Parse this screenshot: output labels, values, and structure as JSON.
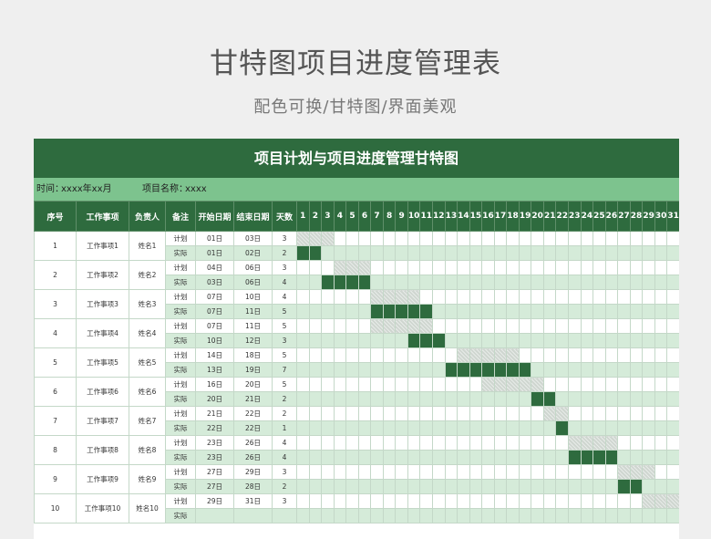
{
  "page": {
    "title": "甘特图项目进度管理表",
    "subtitle": "配色可换/甘特图/界面美观",
    "banner": "项目计划与项目进度管理甘特图",
    "info": {
      "time_label": "时间：",
      "time_value": "xxxx年xx月",
      "project_label": "项目名称：",
      "project_value": "xxxx"
    },
    "headers": {
      "seq": "序号",
      "task": "工作事项",
      "owner": "负责人",
      "note": "备注",
      "start": "开始日期",
      "end": "结束日期",
      "days": "天数"
    },
    "days": [
      "1",
      "2",
      "3",
      "4",
      "5",
      "6",
      "7",
      "8",
      "9",
      "10",
      "11",
      "12",
      "13",
      "14",
      "15",
      "16",
      "17",
      "18",
      "19",
      "20",
      "21",
      "22",
      "23",
      "24",
      "25",
      "26",
      "27",
      "28",
      "29",
      "30",
      "31"
    ]
  },
  "colors": {
    "header_green": "#2e6b3e",
    "info_green": "#7dc38e",
    "actual_row": "#d5ebd9",
    "plan_bar": "#cfd6d0",
    "actual_bar": "#2e6b3e"
  },
  "tasks": [
    {
      "seq": "1",
      "name": "工作事项1",
      "owner": "姓名1",
      "plan": {
        "label": "计划",
        "start": "01日",
        "end": "03日",
        "days": "3",
        "s": 1,
        "e": 3
      },
      "actual": {
        "label": "实际",
        "start": "01日",
        "end": "02日",
        "days": "2",
        "s": 1,
        "e": 2
      }
    },
    {
      "seq": "2",
      "name": "工作事项2",
      "owner": "姓名2",
      "plan": {
        "label": "计划",
        "start": "04日",
        "end": "06日",
        "days": "3",
        "s": 4,
        "e": 6
      },
      "actual": {
        "label": "实际",
        "start": "03日",
        "end": "06日",
        "days": "4",
        "s": 3,
        "e": 6
      }
    },
    {
      "seq": "3",
      "name": "工作事项3",
      "owner": "姓名3",
      "plan": {
        "label": "计划",
        "start": "07日",
        "end": "10日",
        "days": "4",
        "s": 7,
        "e": 10
      },
      "actual": {
        "label": "实际",
        "start": "07日",
        "end": "11日",
        "days": "5",
        "s": 7,
        "e": 11
      }
    },
    {
      "seq": "4",
      "name": "工作事项4",
      "owner": "姓名4",
      "plan": {
        "label": "计划",
        "start": "07日",
        "end": "11日",
        "days": "5",
        "s": 7,
        "e": 11
      },
      "actual": {
        "label": "实际",
        "start": "10日",
        "end": "12日",
        "days": "3",
        "s": 10,
        "e": 12
      }
    },
    {
      "seq": "5",
      "name": "工作事项5",
      "owner": "姓名5",
      "plan": {
        "label": "计划",
        "start": "14日",
        "end": "18日",
        "days": "5",
        "s": 14,
        "e": 18
      },
      "actual": {
        "label": "实际",
        "start": "13日",
        "end": "19日",
        "days": "7",
        "s": 13,
        "e": 19
      }
    },
    {
      "seq": "6",
      "name": "工作事项6",
      "owner": "姓名6",
      "plan": {
        "label": "计划",
        "start": "16日",
        "end": "20日",
        "days": "5",
        "s": 16,
        "e": 20
      },
      "actual": {
        "label": "实际",
        "start": "20日",
        "end": "21日",
        "days": "2",
        "s": 20,
        "e": 21
      }
    },
    {
      "seq": "7",
      "name": "工作事项7",
      "owner": "姓名7",
      "plan": {
        "label": "计划",
        "start": "21日",
        "end": "22日",
        "days": "2",
        "s": 21,
        "e": 22
      },
      "actual": {
        "label": "实际",
        "start": "22日",
        "end": "22日",
        "days": "1",
        "s": 22,
        "e": 22
      }
    },
    {
      "seq": "8",
      "name": "工作事项8",
      "owner": "姓名8",
      "plan": {
        "label": "计划",
        "start": "23日",
        "end": "26日",
        "days": "4",
        "s": 23,
        "e": 26
      },
      "actual": {
        "label": "实际",
        "start": "23日",
        "end": "26日",
        "days": "4",
        "s": 23,
        "e": 26
      }
    },
    {
      "seq": "9",
      "name": "工作事项9",
      "owner": "姓名9",
      "plan": {
        "label": "计划",
        "start": "27日",
        "end": "29日",
        "days": "3",
        "s": 27,
        "e": 29
      },
      "actual": {
        "label": "实际",
        "start": "27日",
        "end": "28日",
        "days": "2",
        "s": 27,
        "e": 28
      }
    },
    {
      "seq": "10",
      "name": "工作事项10",
      "owner": "姓名10",
      "plan": {
        "label": "计划",
        "start": "29日",
        "end": "31日",
        "days": "3",
        "s": 29,
        "e": 31
      },
      "actual": {
        "label": "实际",
        "start": "",
        "end": "",
        "days": "",
        "s": 0,
        "e": 0
      }
    }
  ]
}
